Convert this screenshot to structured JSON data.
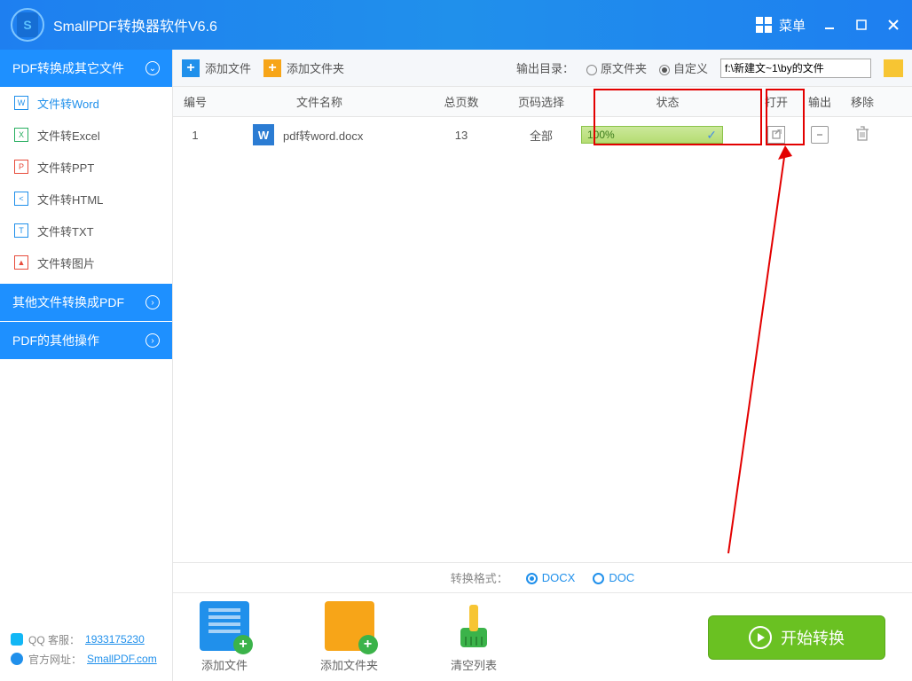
{
  "title": "SmallPDF转换器软件V6.6",
  "titlebar": {
    "menu": "菜单"
  },
  "toolbar": {
    "add_file": "添加文件",
    "add_folder": "添加文件夹",
    "output_label": "输出目录：",
    "opt_same": "原文件夹",
    "opt_custom": "自定义",
    "path": "f:\\新建文~1\\by的文件"
  },
  "sidebar": {
    "groups": [
      {
        "title": "PDF转换成其它文件",
        "expanded": true
      },
      {
        "title": "其他文件转换成PDF",
        "expanded": false
      },
      {
        "title": "PDF的其他操作",
        "expanded": false
      }
    ],
    "items": [
      {
        "label": "文件转Word",
        "active": true,
        "icon": "W",
        "color": "blue"
      },
      {
        "label": "文件转Excel",
        "icon": "X",
        "color": "green"
      },
      {
        "label": "文件转PPT",
        "icon": "P",
        "color": "red"
      },
      {
        "label": "文件转HTML",
        "icon": "H",
        "color": "blue"
      },
      {
        "label": "文件转TXT",
        "icon": "T",
        "color": "blue"
      },
      {
        "label": "文件转图片",
        "icon": "▣",
        "color": "red"
      }
    ],
    "footer": {
      "qq_label": "QQ 客服：",
      "qq_value": "1933175230",
      "site_label": "官方网址：",
      "site_value": "SmallPDF.com"
    }
  },
  "table": {
    "headers": {
      "num": "编号",
      "name": "文件名称",
      "pages": "总页数",
      "sel": "页码选择",
      "status": "状态",
      "open": "打开",
      "out": "输出",
      "del": "移除"
    },
    "rows": [
      {
        "num": "1",
        "name": "pdf转word.docx",
        "pages": "13",
        "sel": "全部",
        "progress": "100%"
      }
    ]
  },
  "format": {
    "label": "转换格式：",
    "docx": "DOCX",
    "doc": "DOC"
  },
  "bottom": {
    "add_file": "添加文件",
    "add_folder": "添加文件夹",
    "clear": "清空列表",
    "start": "开始转换"
  }
}
